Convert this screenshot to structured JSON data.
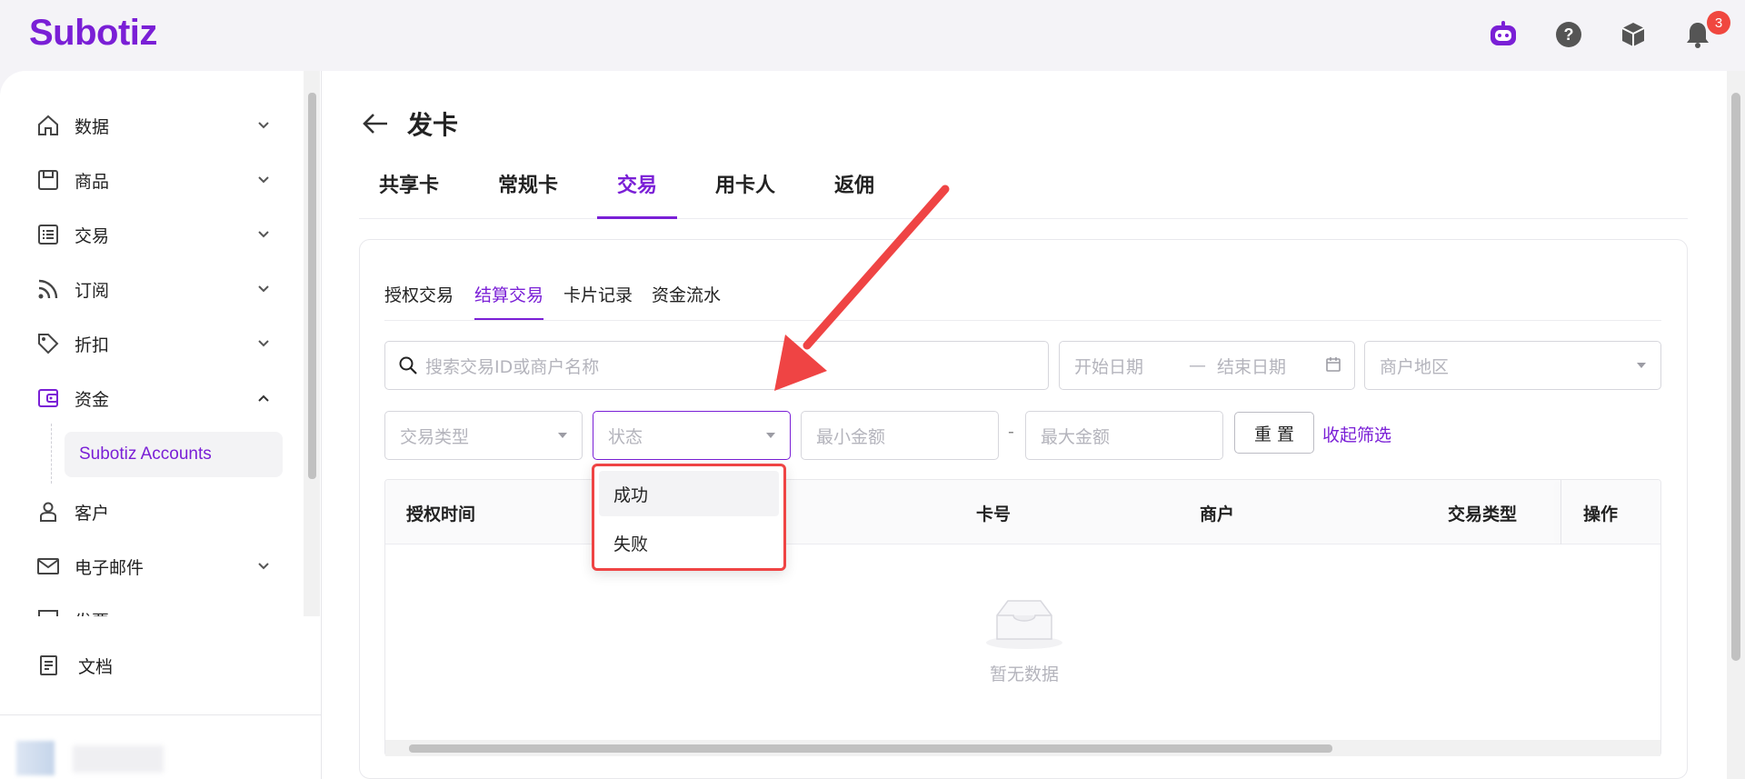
{
  "app": {
    "logo": "Subotiz",
    "notification_count": "3"
  },
  "colors": {
    "accent": "#7a1fd6",
    "annotation": "#ef4444",
    "badge": "#f0473f"
  },
  "header_icons": [
    "robot-assistant-icon",
    "help-icon",
    "package-icon",
    "bell-icon"
  ],
  "sidebar": {
    "items": [
      {
        "label": "数据",
        "icon": "home-icon",
        "expanded": false
      },
      {
        "label": "商品",
        "icon": "store-icon",
        "expanded": false
      },
      {
        "label": "交易",
        "icon": "list-icon",
        "expanded": false
      },
      {
        "label": "订阅",
        "icon": "rss-icon",
        "expanded": false
      },
      {
        "label": "折扣",
        "icon": "tag-icon",
        "expanded": false
      },
      {
        "label": "资金",
        "icon": "wallet-icon",
        "expanded": true
      },
      {
        "label": "客户",
        "icon": "user-icon",
        "expanded": false
      },
      {
        "label": "电子邮件",
        "icon": "mail-icon",
        "expanded": false
      },
      {
        "label": "发票",
        "icon": "invoice-icon",
        "expanded": false
      }
    ],
    "sub_item": "Subotiz Accounts",
    "docs": "文档"
  },
  "page": {
    "title": "发卡",
    "tabs": [
      "共享卡",
      "常规卡",
      "交易",
      "用卡人",
      "返佣"
    ],
    "active_tab": "交易",
    "sub_tabs": [
      "授权交易",
      "结算交易",
      "卡片记录",
      "资金流水"
    ],
    "active_sub_tab": "结算交易"
  },
  "filters": {
    "search_placeholder": "搜索交易ID或商户名称",
    "start_date": "开始日期",
    "date_sep": "—",
    "end_date": "结束日期",
    "region": "商户地区",
    "txn_type": "交易类型",
    "status": "状态",
    "min_amount": "最小金额",
    "range_sep": "-",
    "max_amount": "最大金额",
    "reset": "重 置",
    "collapse": "收起筛选"
  },
  "status_options": [
    "成功",
    "失败"
  ],
  "table": {
    "columns": [
      "授权时间",
      "卡号",
      "商户",
      "交易类型",
      "操作"
    ],
    "empty_text": "暂无数据"
  }
}
